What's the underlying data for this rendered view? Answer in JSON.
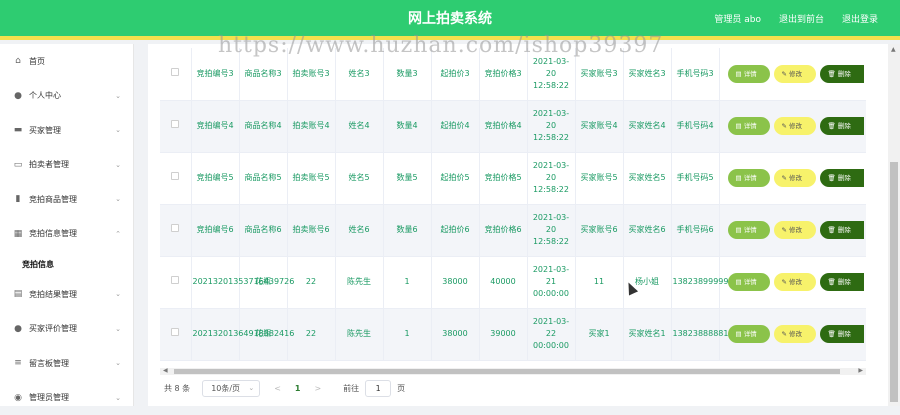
{
  "header": {
    "title": "网上拍卖系统",
    "user": "管理员 abo",
    "exit_frontend": "退出到前台",
    "logout": "退出登录"
  },
  "watermark": "https://www.huzhan.com/ishop39397",
  "sidebar": {
    "items": [
      {
        "label": "首页",
        "icon": "home-icon"
      },
      {
        "label": "个人中心",
        "icon": "user-icon"
      },
      {
        "label": "买家管理",
        "icon": "card-icon"
      },
      {
        "label": "拍卖者管理",
        "icon": "monitor-icon"
      },
      {
        "label": "竞拍商品管理",
        "icon": "bar-chart-icon"
      },
      {
        "label": "竞拍信息管理",
        "icon": "grid-icon"
      },
      {
        "label": "竞拍结果管理",
        "icon": "doc-icon"
      },
      {
        "label": "买家评价管理",
        "icon": "user-icon"
      },
      {
        "label": "留言板管理",
        "icon": "sliders-icon"
      },
      {
        "label": "管理员管理",
        "icon": "users-icon"
      }
    ],
    "subitem": "竞拍信息"
  },
  "table": {
    "rows": [
      [
        "竞拍编号3",
        "商品名称3",
        "拍卖账号3",
        "姓名3",
        "数量3",
        "起拍价3",
        "竞拍价格3",
        "2021-03-20 12:58:22",
        "买家账号3",
        "买家姓名3",
        "手机号码3"
      ],
      [
        "竞拍编号4",
        "商品名称4",
        "拍卖账号4",
        "姓名4",
        "数量4",
        "起拍价4",
        "竞拍价格4",
        "2021-03-20 12:58:22",
        "买家账号4",
        "买家姓名4",
        "手机号码4"
      ],
      [
        "竞拍编号5",
        "商品名称5",
        "拍卖账号5",
        "姓名5",
        "数量5",
        "起拍价5",
        "竞拍价格5",
        "2021-03-20 12:58:22",
        "买家账号5",
        "买家姓名5",
        "手机号码5"
      ],
      [
        "竞拍编号6",
        "商品名称6",
        "拍卖账号6",
        "姓名6",
        "数量6",
        "起拍价6",
        "竞拍价格6",
        "2021-03-20 12:58:22",
        "买家账号6",
        "买家姓名6",
        "手机号码6"
      ],
      [
        "20213201353716439726",
        "花瓶",
        "22",
        "陈先生",
        "1",
        "38000",
        "40000",
        "2021-03-21 00:00:00",
        "11",
        "杨小姐",
        "13823899999"
      ],
      [
        "20213201364918382416",
        "花瓶",
        "22",
        "陈先生",
        "1",
        "38000",
        "39000",
        "2021-03-22 00:00:00",
        "买家1",
        "买家姓名1",
        "13823888881"
      ]
    ],
    "actions": {
      "detail": "详情",
      "edit": "修改",
      "delete": "删除"
    }
  },
  "pager": {
    "total": "共 8 条",
    "page_size": "10条/页",
    "current_page": "1",
    "goto_label": "前往",
    "goto_value": "1",
    "goto_unit": "页"
  },
  "colors": {
    "header": "#2ecc71",
    "accent_stripe": "#f4e04d",
    "text_green": "#1a9a63",
    "detail_btn": "#8bc34a",
    "edit_btn": "#f7f26b",
    "delete_btn": "#2e6b12"
  }
}
